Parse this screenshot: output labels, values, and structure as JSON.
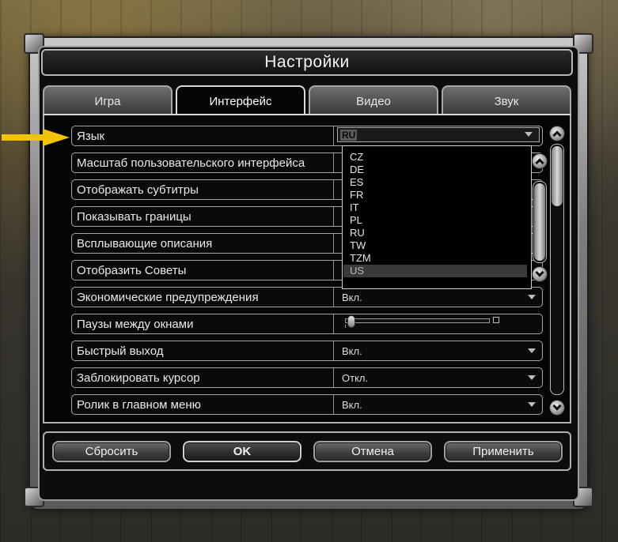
{
  "window": {
    "title": "Настройки"
  },
  "tabs": [
    {
      "label": "Игра",
      "active": false
    },
    {
      "label": "Интерфейс",
      "active": true
    },
    {
      "label": "Видео",
      "active": false
    },
    {
      "label": "Звук",
      "active": false
    }
  ],
  "settings": [
    {
      "label": "Язык",
      "value": "RU",
      "control": "dropdown-open"
    },
    {
      "label": "Масштаб пользовательского интерфейса",
      "value": "",
      "control": "hidden"
    },
    {
      "label": "Отображать субтитры",
      "value": "",
      "control": "hidden"
    },
    {
      "label": "Показывать границы",
      "value": "",
      "control": "hidden"
    },
    {
      "label": "Всплывающие описания",
      "value": "",
      "control": "hidden"
    },
    {
      "label": "Отобразить Советы",
      "value": "",
      "control": "hidden"
    },
    {
      "label": "Экономические предупреждения",
      "value": "Вкл.",
      "control": "dropdown"
    },
    {
      "label": "Паузы между окнами",
      "slider_level": 0.02,
      "control": "slider"
    },
    {
      "label": "Быстрый выход",
      "value": "Вкл.",
      "control": "dropdown"
    },
    {
      "label": "Заблокировать курсор",
      "value": "Откл.",
      "control": "dropdown"
    },
    {
      "label": "Ролик в главном меню",
      "value": "Вкл.",
      "control": "dropdown"
    }
  ],
  "language_dropdown": {
    "selected": "RU",
    "options": [
      "CZ",
      "DE",
      "ES",
      "FR",
      "IT",
      "PL",
      "RU",
      "TW",
      "TZM",
      "US"
    ],
    "highlighted": "US"
  },
  "buttons": {
    "reset": "Сбросить",
    "ok": "OK",
    "cancel": "Отмена",
    "apply": "Применить"
  },
  "icons": {
    "scroll_up": "chevron-up-icon",
    "scroll_down": "chevron-down-icon",
    "pointer": "yellow-arrow-icon"
  },
  "colors": {
    "pointer": "#f2c300",
    "panel_bg": "#050505",
    "frame": "#9c9c9c"
  }
}
